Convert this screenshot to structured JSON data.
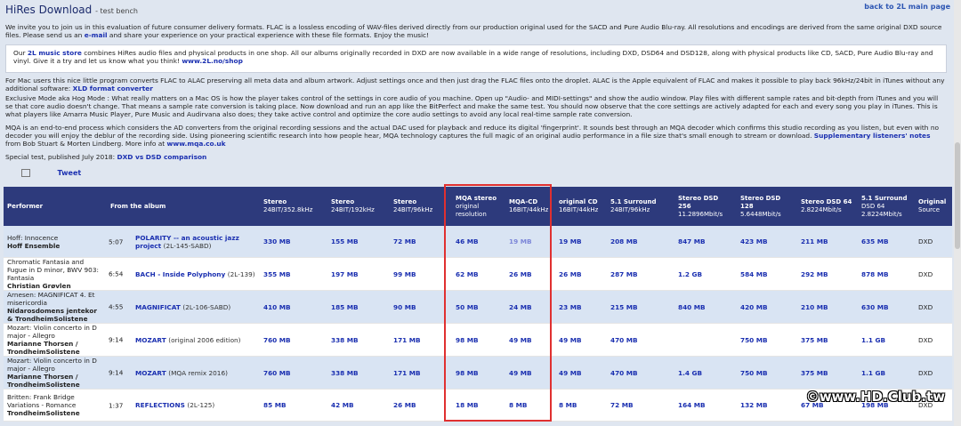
{
  "header": {
    "title": "HiRes Download",
    "subtitle": "- test bench",
    "back_link": "back to 2L main page"
  },
  "intro": {
    "t1": "We invite you to join us in this evaluation of future consumer delivery formats. FLAC is a lossless encoding of WAV-files derived directly from our production original used for the SACD and Pure Audio Blu-ray. All resolutions and encodings are derived from the same original DXD source files. Please send us an",
    "email_link": "e-mail",
    "t2": "and share your experience on your practical experience with these file formats. Enjoy the music!"
  },
  "store_box": {
    "t1": "Our",
    "store_link": "2L music store",
    "t2": "combines HiRes audio files and physical products in one shop. All our albums originally recorded in DXD are now available in a wide range of resolutions, including DXD, DSD64 and DSD128, along with physical products like CD, SACD, Pure Audio Blu-ray and vinyl. Give it a try and let us know what you think!",
    "shop_link": "www.2L.no/shop"
  },
  "mac_para": {
    "t1": "For Mac users this nice little program converts FLAC to ALAC preserving all meta data and album artwork. Adjust settings once and then just drag the FLAC files onto the droplet. ALAC is the Apple equivalent of FLAC and makes it possible to play back 96kHz/24bit in iTunes without any additional software:",
    "xld_link": "XLD format converter"
  },
  "hog_para": "Exclusive Mode aka Hog Mode : What really matters on a Mac OS is how the player takes control of the settings in core audio of you machine. Open up \"Audio- and MIDI-settings\" and show the audio window. Play files with different sample rates and bit-depth from iTunes and you will se that core audio doesn't change. That means a sample rate conversion is taking place. Now download and run an app like the BitPerfect and make the same test. You should now observe that the core settings are actively adapted for each and every song you play in iTunes. This is what players like Amarra Music Player, Pure Music and Audirvana also does; they take active control and optimize the core audio settings to avoid any local real-time sample rate conversion.",
  "mqa_para": {
    "t1": "MQA is an end-to-end process which considers the AD converters from the original recording sessions and the actual DAC used for playback and reduce its digital 'fingerprint'. It sounds best through an MQA decoder which confirms this studio recording as you listen, but even with no decoder you will enjoy the deblur of the recording side. Using pioneering scientific research into how people hear, MQA technology captures the full magic of an original audio performance in a file size that's small enough to stream or download.",
    "notes_link": "Supplementary listeners' notes",
    "t2": "from Bob Stuart & Morten Lindberg. More info at",
    "mqa_link": "www.mqa.co.uk"
  },
  "special": {
    "t1": "Special test, published July 2018:",
    "link": "DXD vs DSD comparison"
  },
  "tweet": {
    "icon": "image-placeholder-icon",
    "label": "Tweet"
  },
  "table": {
    "headers": [
      {
        "main": "Performer",
        "sub": ""
      },
      {
        "main": "From the album",
        "sub": ""
      },
      {
        "main": "Stereo",
        "sub": "24BIT/352.8kHz"
      },
      {
        "main": "Stereo",
        "sub": "24BIT/192kHz"
      },
      {
        "main": "Stereo",
        "sub": "24BIT/96kHz"
      },
      {
        "main": "MQA stereo",
        "sub": "original resolution"
      },
      {
        "main": "MQA-CD",
        "sub": "16BIT/44kHz"
      },
      {
        "main": "original CD",
        "sub": "16BIT/44kHz"
      },
      {
        "main": "5.1 Surround",
        "sub": "24BIT/96kHz"
      },
      {
        "main": "Stereo DSD 256",
        "sub": "11.2896Mbit/s"
      },
      {
        "main": "Stereo DSD 128",
        "sub": "5.6448Mbit/s"
      },
      {
        "main": "Stereo DSD 64",
        "sub": "2.8224Mbit/s"
      },
      {
        "main": "5.1 Surround",
        "sub": "DSD 64 2.8224Mbit/s"
      },
      {
        "main": "Original",
        "sub": "Source"
      }
    ],
    "rows": [
      {
        "work": "Hoff: Innocence",
        "artist": "Hoff Ensemble",
        "time": "5:07",
        "album": "POLARITY -- an acoustic jazz project",
        "cat": "(2L-145-SABD)",
        "sizes": [
          "330 MB",
          "155 MB",
          "72 MB",
          "46 MB",
          "19 MB",
          "19 MB",
          "208 MB",
          "847 MB",
          "423 MB",
          "211 MB",
          "635 MB"
        ],
        "source": "DXD"
      },
      {
        "work": "Chromatic Fantasia and Fugue in D minor, BWV 903: Fantasia",
        "artist": "Christian Grøvlen",
        "time": "6:54",
        "album": "BACH - Inside Polyphony",
        "cat": "(2L-139)",
        "sizes": [
          "355 MB",
          "197 MB",
          "99 MB",
          "62 MB",
          "26 MB",
          "26 MB",
          "287 MB",
          "1.2 GB",
          "584 MB",
          "292 MB",
          "878 MB"
        ],
        "source": "DXD"
      },
      {
        "work": "Arnesen: MAGNIFICAT 4. Et misericordia",
        "artist": "Nidarosdomens jentekor & TrondheimSolistene",
        "time": "4:55",
        "album": "MAGNIFICAT",
        "cat": "(2L-106-SABD)",
        "sizes": [
          "410 MB",
          "185 MB",
          "90 MB",
          "50 MB",
          "24 MB",
          "23 MB",
          "215 MB",
          "840 MB",
          "420 MB",
          "210 MB",
          "630 MB"
        ],
        "source": "DXD"
      },
      {
        "work": "Mozart: Violin concerto in D major - Allegro",
        "artist": "Marianne Thorsen / TrondheimSolistene",
        "time": "9:14",
        "album": "MOZART",
        "cat": "(original 2006 edition)",
        "sizes": [
          "760 MB",
          "338 MB",
          "171 MB",
          "98 MB",
          "49 MB",
          "49 MB",
          "470 MB",
          "",
          "750 MB",
          "375 MB",
          "1.1 GB"
        ],
        "source": "DXD"
      },
      {
        "work": "Mozart: Violin concerto in D major - Allegro",
        "artist": "Marianne Thorsen / TrondheimSolistene",
        "time": "9:14",
        "album": "MOZART",
        "cat": "(MQA remix 2016)",
        "sizes": [
          "760 MB",
          "338 MB",
          "171 MB",
          "98 MB",
          "49 MB",
          "49 MB",
          "470 MB",
          "1.4 GB",
          "750 MB",
          "375 MB",
          "1.1 GB"
        ],
        "source": "DXD"
      },
      {
        "work": "Britten: Frank Bridge Variations - Romance",
        "artist": "TrondheimSolistene",
        "time": "1:37",
        "album": "REFLECTIONS",
        "cat": "(2L-125)",
        "sizes": [
          "85 MB",
          "42 MB",
          "26 MB",
          "18 MB",
          "8 MB",
          "8 MB",
          "72 MB",
          "164 MB",
          "132 MB",
          "67 MB",
          "198 MB"
        ],
        "source": "DXD"
      }
    ]
  },
  "watermark": "©www.HD.Club.tw"
}
